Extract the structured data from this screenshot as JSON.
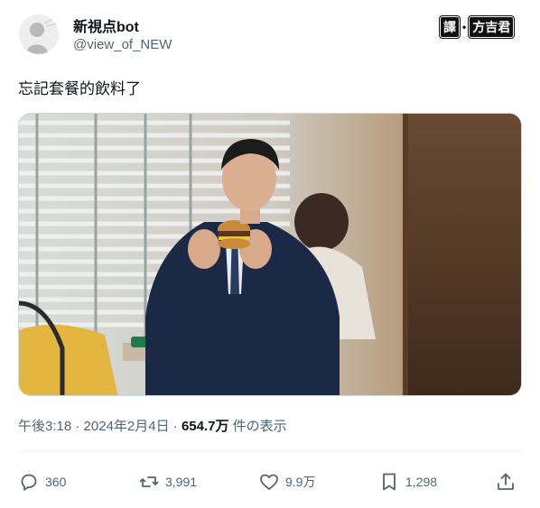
{
  "user": {
    "display_name": "新視点bot",
    "handle": "@view_of_NEW"
  },
  "watermark": {
    "part1": "譯",
    "part2": "方吉君"
  },
  "tweet": {
    "text": "忘記套餐的飲料了"
  },
  "meta": {
    "time": "午後3:18",
    "sep1": " · ",
    "date": "2024年2月4日",
    "sep2": " · ",
    "views_count": "654.7万",
    "views_label": " 件の表示"
  },
  "actions": {
    "replies": "360",
    "retweets": "3,991",
    "likes": "9.9万",
    "bookmarks": "1,298"
  },
  "icons": [
    "default-avatar-icon",
    "reply-icon",
    "retweet-icon",
    "like-icon",
    "bookmark-icon",
    "share-icon"
  ]
}
